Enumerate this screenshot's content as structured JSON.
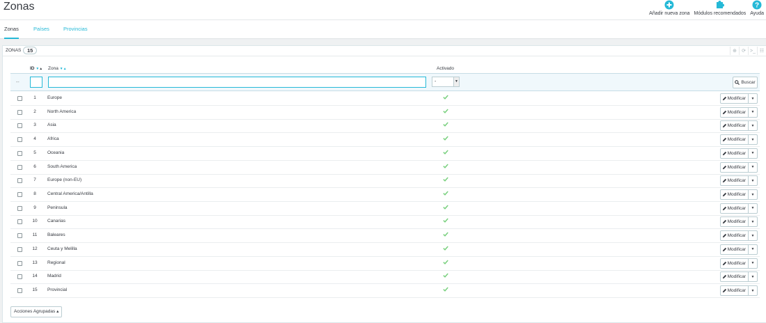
{
  "page": {
    "title": "Zonas"
  },
  "toolbar": [
    {
      "label": "Añadir nueva zona",
      "icon": "plus-circle-icon"
    },
    {
      "label": "Módulos recomendados",
      "icon": "puzzle-icon"
    },
    {
      "label": "Ayuda",
      "icon": "help-icon"
    }
  ],
  "tabs": [
    {
      "label": "Zonas",
      "active": true
    },
    {
      "label": "Países",
      "active": false
    },
    {
      "label": "Provincias",
      "active": false
    }
  ],
  "panel": {
    "title": "Zonas",
    "count": "15"
  },
  "table": {
    "headers": {
      "id": "ID",
      "zone": "Zona",
      "active": "Activado"
    },
    "filter": {
      "placeholder_dash": "--",
      "select_value": "-",
      "search_label": "Buscar"
    },
    "rows": [
      {
        "id": "1",
        "name": "Europe"
      },
      {
        "id": "2",
        "name": "North America"
      },
      {
        "id": "3",
        "name": "Asia"
      },
      {
        "id": "4",
        "name": "Africa"
      },
      {
        "id": "5",
        "name": "Oceania"
      },
      {
        "id": "6",
        "name": "South America"
      },
      {
        "id": "7",
        "name": "Europe (non-EU)"
      },
      {
        "id": "8",
        "name": "Central America/Antilla"
      },
      {
        "id": "9",
        "name": "Peninsula"
      },
      {
        "id": "10",
        "name": "Canarias"
      },
      {
        "id": "11",
        "name": "Baleares"
      },
      {
        "id": "12",
        "name": "Ceuta y Melilla"
      },
      {
        "id": "13",
        "name": "Regional"
      },
      {
        "id": "14",
        "name": "Madrid"
      },
      {
        "id": "15",
        "name": "Provincial"
      }
    ],
    "row_action": "Modificar"
  },
  "bulk_label": "Acciones Agrupadas",
  "colors": {
    "accent": "#25b9d7",
    "check": "#78d07d",
    "text": "#363a41"
  }
}
